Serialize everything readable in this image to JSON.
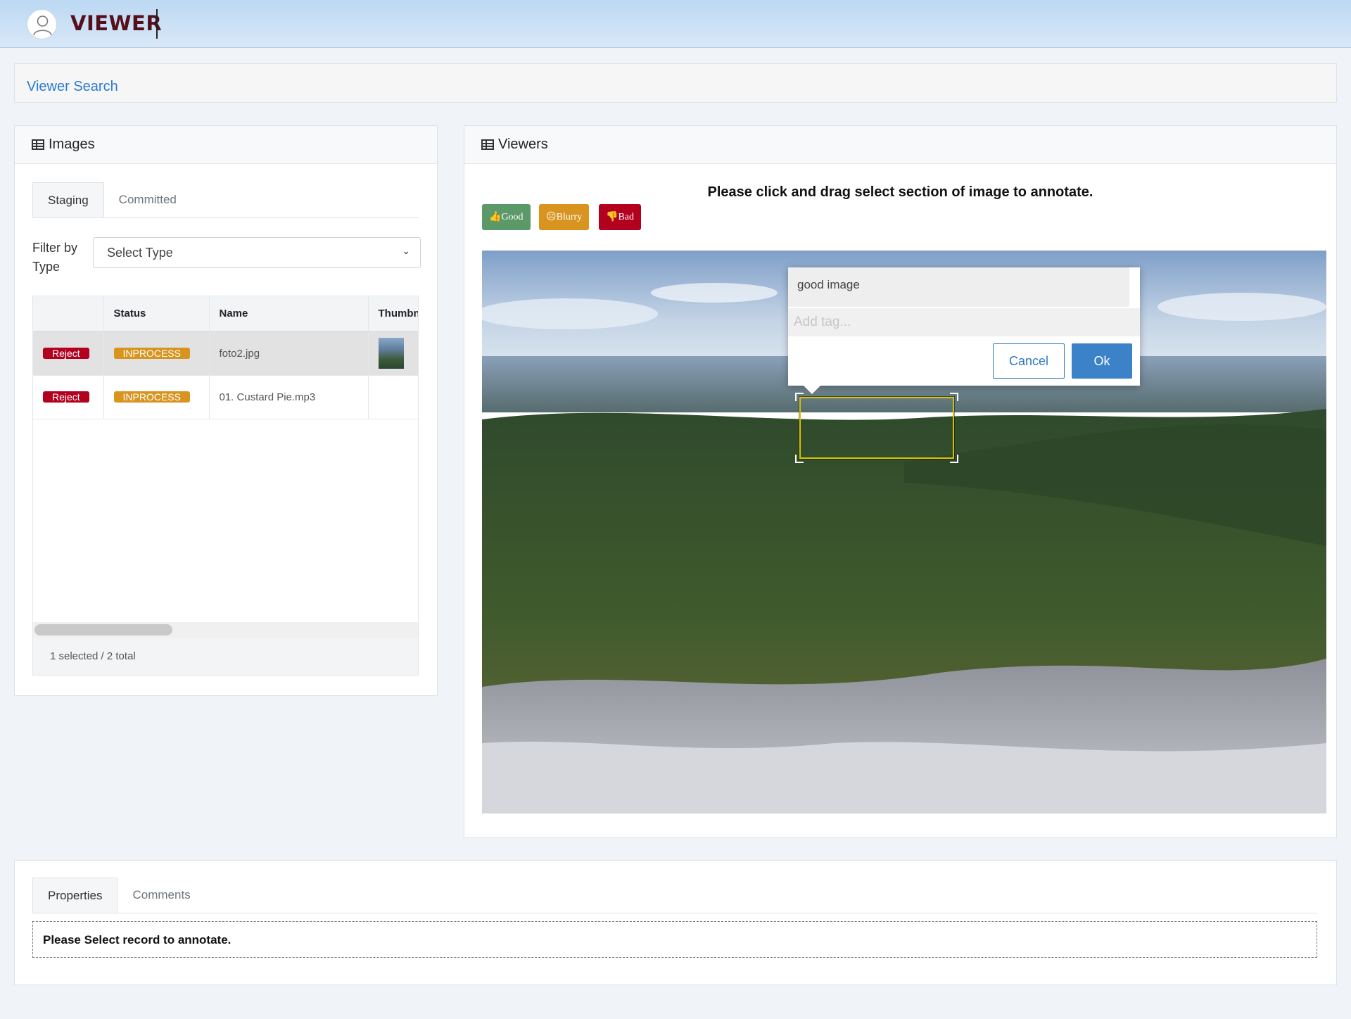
{
  "header": {
    "brand": "VIEWER"
  },
  "search": {
    "link_label": "Viewer Search"
  },
  "images_panel": {
    "title": "Images",
    "tabs": [
      {
        "label": "Staging",
        "active": true
      },
      {
        "label": "Committed",
        "active": false
      }
    ],
    "filter_label_line1": "Filter by",
    "filter_label_line2": "Type",
    "filter_selected": "Select Type",
    "columns": [
      "",
      "Status",
      "Name",
      "Thumbn"
    ],
    "rows": [
      {
        "action": "Reject",
        "status": "INPROCESS",
        "name": "foto2.jpg",
        "selected": true,
        "has_thumb": true
      },
      {
        "action": "Reject",
        "status": "INPROCESS",
        "name": "01. Custard Pie.mp3",
        "selected": false,
        "has_thumb": false
      }
    ],
    "footer": "1 selected / 2 total"
  },
  "viewers_panel": {
    "title": "Viewers",
    "instruction": "Please click and drag select section of image to annotate.",
    "quality_buttons": {
      "good": "Good",
      "blurry": "Blurry",
      "bad": "Bad"
    },
    "annotation": {
      "text": "good image",
      "tag_placeholder": "Add tag...",
      "cancel_label": "Cancel",
      "ok_label": "Ok"
    }
  },
  "bottom_panel": {
    "tabs": [
      {
        "label": "Properties",
        "active": true
      },
      {
        "label": "Comments",
        "active": false
      }
    ],
    "notice": "Please Select record to annotate."
  },
  "colors": {
    "reject": "#b3001f",
    "status_inprocess": "#d99420",
    "good": "#5b9a68",
    "blurry": "#d99420",
    "bad": "#b3001f",
    "link": "#2c7ad6",
    "brand": "#55101c",
    "ok_button": "#3b82c9"
  },
  "icons": [
    "user-avatar-icon",
    "table-grid-icon",
    "thumbs-up-icon",
    "frown-icon",
    "thumbs-down-icon",
    "chevron-down-icon"
  ]
}
